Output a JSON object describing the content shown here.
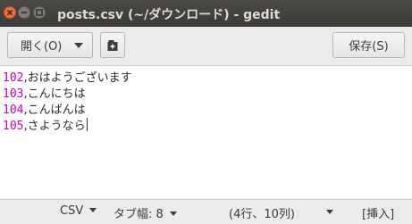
{
  "window": {
    "title": "posts.csv (~/ダウンロード) - gedit"
  },
  "toolbar": {
    "open_label": "開く(O)",
    "new_tab_icon": "new-document-icon",
    "save_label": "保存(S)"
  },
  "editor": {
    "lines": [
      {
        "num": "102",
        "text": ",おはようございます"
      },
      {
        "num": "103",
        "text": ",こんにちは"
      },
      {
        "num": "104",
        "text": ",こんばんは"
      },
      {
        "num": "105",
        "text": ",さようなら"
      }
    ]
  },
  "status": {
    "language": "CSV",
    "tab_width": "タブ幅: 8",
    "position": "(4行、10列)",
    "mode": "[挿入]"
  },
  "colors": {
    "number": "#c200c2",
    "close_button": "#f46b3b",
    "titlebar": "#3c3b37"
  }
}
